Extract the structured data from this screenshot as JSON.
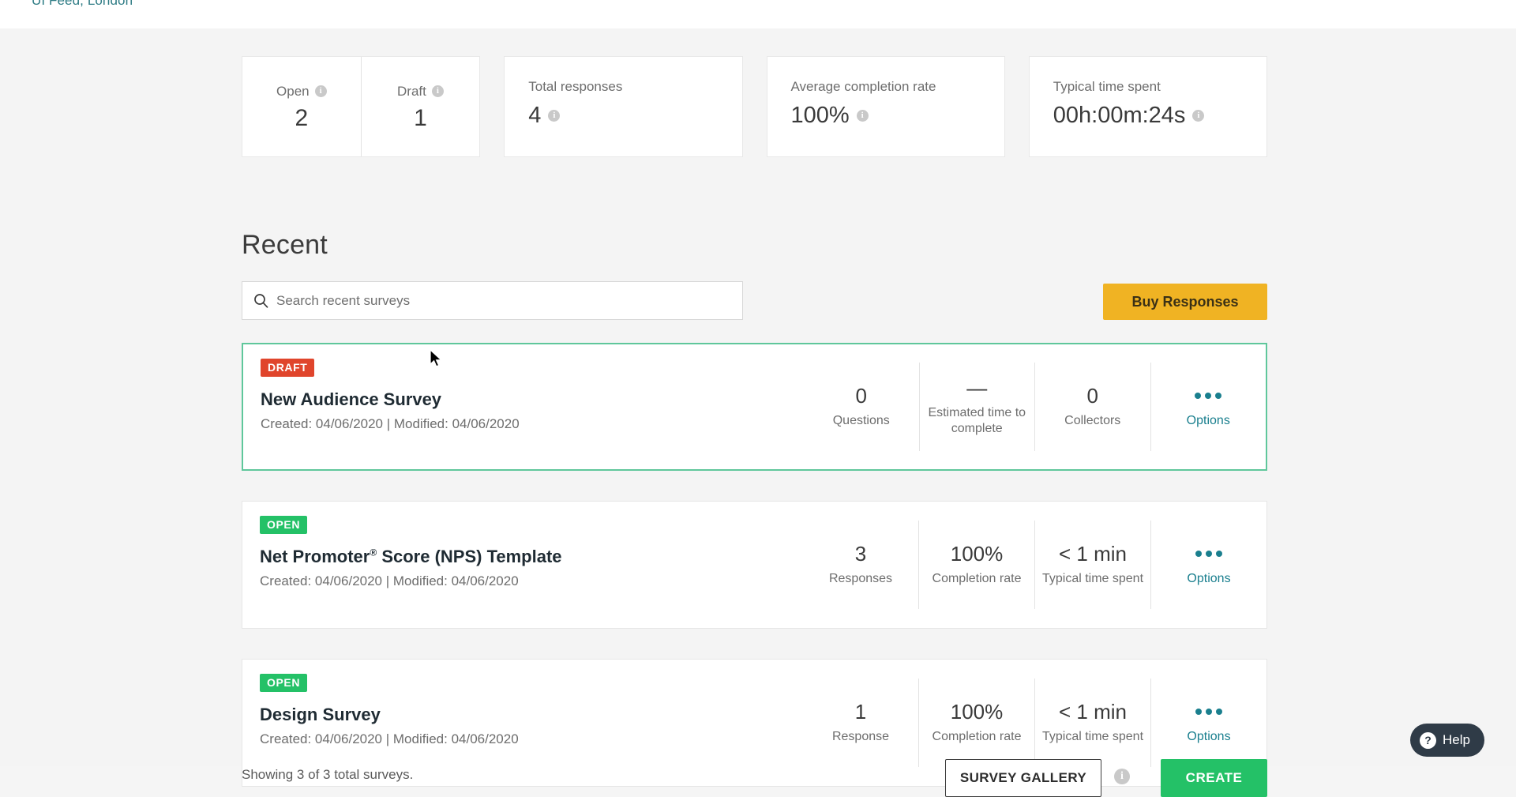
{
  "topbar": {
    "text": "UI Feed, London"
  },
  "summary": {
    "status_card": {
      "open": {
        "label": "Open",
        "value": "2",
        "info": "i"
      },
      "draft": {
        "label": "Draft",
        "value": "1",
        "info": "i"
      }
    },
    "metrics": [
      {
        "label": "Total responses",
        "value": "4",
        "info": "i"
      },
      {
        "label": "Average completion rate",
        "value": "100%",
        "info": "i"
      },
      {
        "label": "Typical time spent",
        "value": "00h:00m:24s",
        "info": "i"
      }
    ]
  },
  "recent": {
    "title": "Recent",
    "search_placeholder": "Search recent surveys",
    "search_value": "",
    "buy_label": "Buy Responses",
    "buy_color": "#f0b323"
  },
  "surveys": [
    {
      "status": "DRAFT",
      "status_type": "draft",
      "status_color": "#e0452c",
      "name": "New Audience Survey",
      "name_sup": "",
      "dates": "Created: 04/06/2020   |   Modified: 04/06/2020",
      "selected": true,
      "stats": [
        {
          "value": "0",
          "label": "Questions"
        },
        {
          "value": "—",
          "label": "Estimated time to complete"
        },
        {
          "value": "0",
          "label": "Collectors"
        }
      ],
      "options_label": "Options"
    },
    {
      "status": "OPEN",
      "status_type": "open",
      "status_color": "#24c167",
      "name": "Net Promoter",
      "name_sup": "®",
      "name_rest": " Score (NPS) Template",
      "dates": "Created: 04/06/2020   |   Modified: 04/06/2020",
      "selected": false,
      "stats": [
        {
          "value": "3",
          "label": "Responses"
        },
        {
          "value": "100%",
          "label": "Completion rate"
        },
        {
          "value": "< 1 min",
          "label": "Typical time spent"
        }
      ],
      "options_label": "Options"
    },
    {
      "status": "OPEN",
      "status_type": "open",
      "status_color": "#24c167",
      "name": "Design Survey",
      "name_sup": "",
      "dates": "Created: 04/06/2020   |   Modified: 04/06/2020",
      "selected": false,
      "stats": [
        {
          "value": "1",
          "label": "Response"
        },
        {
          "value": "100%",
          "label": "Completion rate"
        },
        {
          "value": "< 1 min",
          "label": "Typical time spent"
        }
      ],
      "options_label": "Options"
    }
  ],
  "footer": {
    "note": "Showing 3 of 3 total surveys.",
    "gallery_label": "SURVEY GALLERY",
    "gallery_info": "i",
    "create_label": "CREATE",
    "create_color": "#24c167"
  },
  "help": {
    "label": "Help",
    "glyph": "?"
  }
}
